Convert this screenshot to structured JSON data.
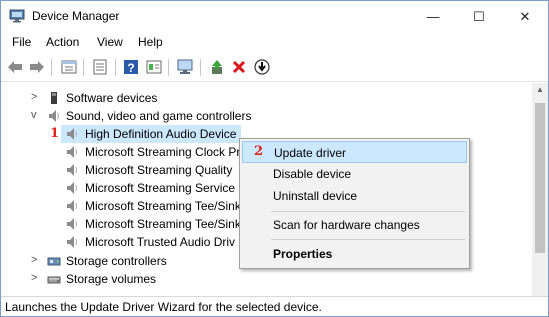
{
  "window": {
    "title": "Device Manager",
    "minimize_glyph": "—",
    "maximize_glyph": "☐",
    "close_glyph": "✕"
  },
  "menu": {
    "items": [
      "File",
      "Action",
      "View",
      "Help"
    ]
  },
  "toolbar": {
    "icons": [
      "back-arrow-icon",
      "forward-arrow-icon",
      "properties-icon",
      "show-hide-icon",
      "help-icon",
      "action-view-icon",
      "scan-monitor-icon",
      "update-driver-icon",
      "uninstall-x-icon",
      "download-icon"
    ],
    "uninstall_color": "#d9141e"
  },
  "tree": {
    "chevron_collapsed": ">",
    "chevron_expanded": "v",
    "rows": [
      {
        "label": "Software devices",
        "expanded": false,
        "level": 1,
        "icon": "software-device-icon"
      },
      {
        "label": "Sound, video and game controllers",
        "expanded": true,
        "level": 1,
        "icon": "speaker-icon"
      },
      {
        "label": "High Definition Audio Device",
        "level": 2,
        "selected": true,
        "step": "1",
        "icon": "speaker-icon"
      },
      {
        "label": "Microsoft Streaming Clock Pr",
        "level": 2,
        "icon": "speaker-icon"
      },
      {
        "label": "Microsoft Streaming Quality",
        "level": 2,
        "icon": "speaker-icon"
      },
      {
        "label": "Microsoft Streaming Service I",
        "level": 2,
        "icon": "speaker-icon"
      },
      {
        "label": "Microsoft Streaming Tee/Sink",
        "level": 2,
        "icon": "speaker-icon"
      },
      {
        "label": "Microsoft Streaming Tee/Sink",
        "level": 2,
        "icon": "speaker-icon"
      },
      {
        "label": "Microsoft Trusted Audio Driv",
        "level": 2,
        "icon": "speaker-icon"
      },
      {
        "label": "Storage controllers",
        "expanded": false,
        "level": 1,
        "icon": "storage-controller-icon"
      },
      {
        "label": "Storage volumes",
        "expanded": false,
        "level": 1,
        "icon": "storage-volume-icon"
      }
    ]
  },
  "context_menu": {
    "step": "2",
    "items": [
      {
        "label": "Update driver",
        "highlighted": true
      },
      {
        "label": "Disable device"
      },
      {
        "label": "Uninstall device"
      },
      {
        "label": "Scan for hardware changes"
      },
      {
        "label": "Properties",
        "bold": true
      }
    ],
    "highlight_color": "#cce8ff"
  },
  "status": {
    "text": "Launches the Update Driver Wizard for the selected device."
  },
  "colors": {
    "selection": "#cce8ff",
    "step_number": "#e0201b"
  }
}
